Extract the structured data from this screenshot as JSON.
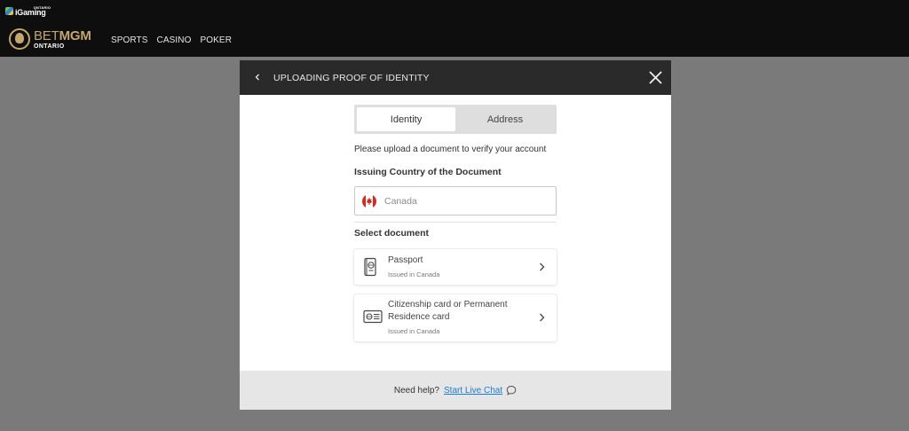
{
  "header": {
    "igaming": {
      "brand": "iGaming",
      "region": "ONTARIO"
    },
    "logo": {
      "bet": "BET",
      "mgm": "MGM",
      "region": "ONTARIO"
    },
    "nav": [
      "SPORTS",
      "CASINO",
      "POKER"
    ],
    "colors": {
      "background": "#0e0e0e",
      "gold": "#c3a66b"
    }
  },
  "modal": {
    "title": "UPLOADING PROOF OF IDENTITY",
    "back_icon": "chevron-left-icon",
    "close_icon": "close-x-icon",
    "tabs": [
      {
        "label": "Identity",
        "active": true
      },
      {
        "label": "Address",
        "active": false
      }
    ],
    "instruction": "Please upload a document to verify your account",
    "country_label": "Issuing Country of the Document",
    "country_field": {
      "value": "Canada",
      "flag_icon": "canada-flag-icon"
    },
    "select_label": "Select document",
    "documents": [
      {
        "title": "Passport",
        "subtitle": "Issued in Canada",
        "icon": "passport-icon"
      },
      {
        "title_line1": "Citizenship card or Permanent",
        "title_line2": "Residence card",
        "subtitle": "Issued in Canada",
        "icon": "id-card-icon"
      }
    ],
    "footer": {
      "help": "Need help?",
      "link": "Start Live Chat",
      "icon": "chat-bubble-icon"
    }
  },
  "colors": {
    "overlay": "#7a7a7a",
    "link": "#1a7bd6",
    "modal_header": "#2a2a2a",
    "canada_red": "#d52b1e"
  }
}
